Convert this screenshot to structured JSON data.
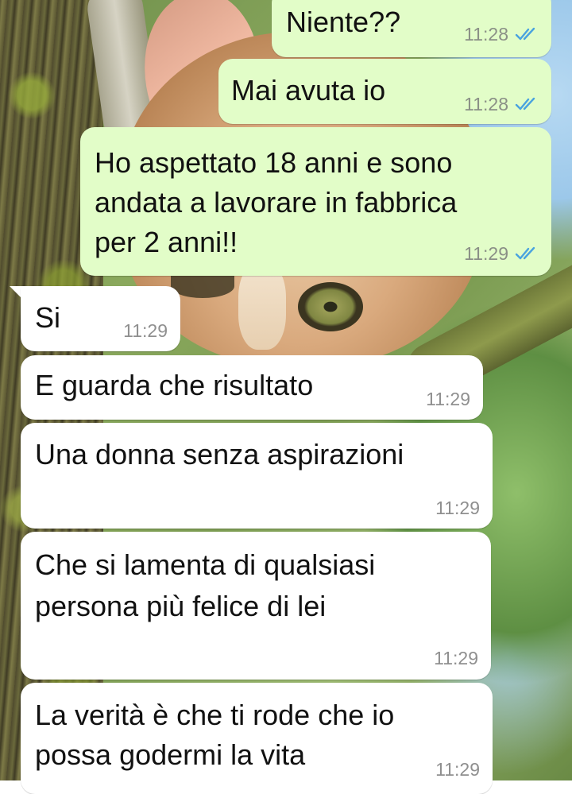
{
  "colors": {
    "outgoing_bubble": "#e2fdc8",
    "incoming_bubble": "#ffffff",
    "timestamp": "#8a8f86",
    "read_ticks": "#4aa3df"
  },
  "messages": [
    {
      "direction": "outgoing",
      "text": "Niente??",
      "time": "11:28",
      "status_icon": "double-check-read-icon"
    },
    {
      "direction": "outgoing",
      "text": "Mai avuta io",
      "time": "11:28",
      "status_icon": "double-check-read-icon"
    },
    {
      "direction": "outgoing",
      "text": "Ho aspettato 18 anni e sono\nandata a lavorare in fabbrica\nper 2 anni!!",
      "time": "11:29",
      "status_icon": "double-check-read-icon"
    },
    {
      "direction": "incoming",
      "text": "Si",
      "time": "11:29"
    },
    {
      "direction": "incoming",
      "text": "E guarda che risultato",
      "time": "11:29"
    },
    {
      "direction": "incoming",
      "text": "Una donna senza aspirazioni",
      "time": "11:29"
    },
    {
      "direction": "incoming",
      "text": "Che si lamenta di qualsiasi\npersona più felice di lei",
      "time": "11:29"
    },
    {
      "direction": "incoming",
      "text": "La verità è che ti rode che io\npossa godermi la vita",
      "time": "11:29"
    }
  ]
}
